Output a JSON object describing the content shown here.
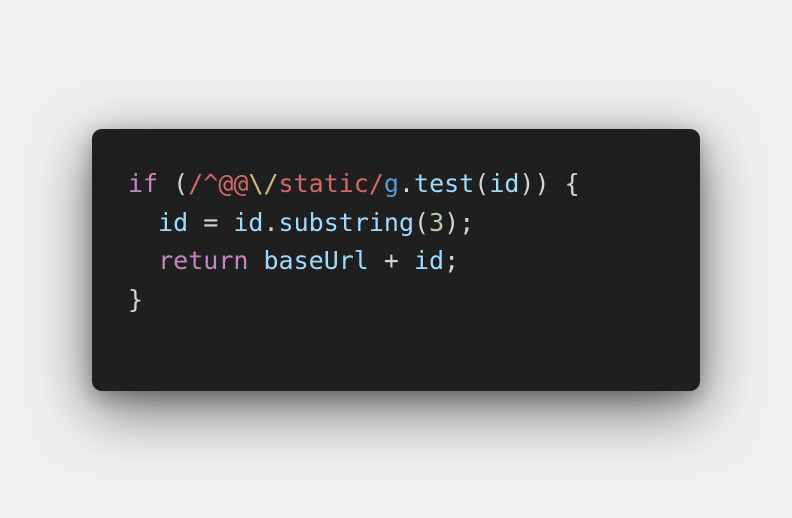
{
  "colors": {
    "background": "#efefef",
    "card": "#1f1f1f",
    "default": "#d4d4d4",
    "keyword": "#c586c0",
    "regex": "#d16969",
    "regex_escape": "#d7ba7d",
    "regex_flag": "#569cd6",
    "variable": "#9cdcfe",
    "function": "#dcdcaa",
    "number": "#b5cea8"
  },
  "code": {
    "lines": [
      {
        "tokens": [
          {
            "text": "if",
            "kind": "keyword"
          },
          {
            "text": " (",
            "kind": "default"
          },
          {
            "text": "/^@@",
            "kind": "regex"
          },
          {
            "text": "\\/",
            "kind": "regex_escape"
          },
          {
            "text": "static/",
            "kind": "regex"
          },
          {
            "text": "g",
            "kind": "regex_flag"
          },
          {
            "text": ".",
            "kind": "default"
          },
          {
            "text": "test",
            "kind": "variable"
          },
          {
            "text": "(",
            "kind": "default"
          },
          {
            "text": "id",
            "kind": "variable"
          },
          {
            "text": ")) {",
            "kind": "default"
          }
        ]
      },
      {
        "tokens": [
          {
            "text": "  ",
            "kind": "default"
          },
          {
            "text": "id",
            "kind": "variable"
          },
          {
            "text": " = ",
            "kind": "default"
          },
          {
            "text": "id",
            "kind": "variable"
          },
          {
            "text": ".",
            "kind": "default"
          },
          {
            "text": "substring",
            "kind": "variable"
          },
          {
            "text": "(",
            "kind": "default"
          },
          {
            "text": "3",
            "kind": "number"
          },
          {
            "text": ");",
            "kind": "default"
          }
        ]
      },
      {
        "tokens": [
          {
            "text": "  ",
            "kind": "default"
          },
          {
            "text": "return",
            "kind": "keyword"
          },
          {
            "text": " ",
            "kind": "default"
          },
          {
            "text": "baseUrl",
            "kind": "variable"
          },
          {
            "text": " + ",
            "kind": "default"
          },
          {
            "text": "id",
            "kind": "variable"
          },
          {
            "text": ";",
            "kind": "default"
          }
        ]
      },
      {
        "tokens": [
          {
            "text": "}",
            "kind": "default"
          }
        ]
      }
    ]
  }
}
